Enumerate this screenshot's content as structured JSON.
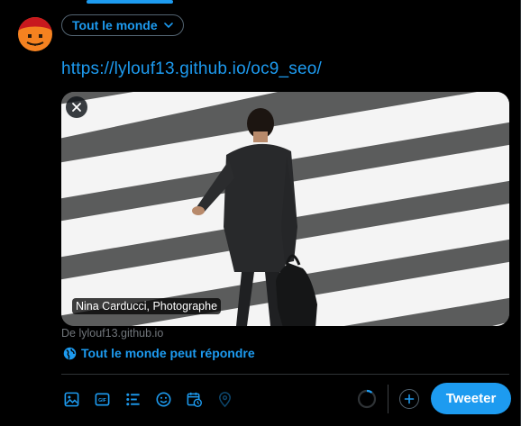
{
  "composer": {
    "audience_label": "Tout le monde",
    "tweet_text": "https://lylouf13.github.io/oc9_seo/",
    "reply_setting": "Tout le monde peut répondre",
    "tweet_button": "Tweeter"
  },
  "link_card": {
    "image_label": "Nina Carducci, Photographe",
    "domain": "De lylouf13.github.io"
  },
  "toolbar": {
    "icons": [
      "image-icon",
      "gif-icon",
      "poll-icon",
      "emoji-icon",
      "schedule-icon",
      "location-icon"
    ]
  },
  "colors": {
    "accent": "#1d9bf0",
    "background": "#000000",
    "muted": "#71767b",
    "border": "#2f3336"
  }
}
